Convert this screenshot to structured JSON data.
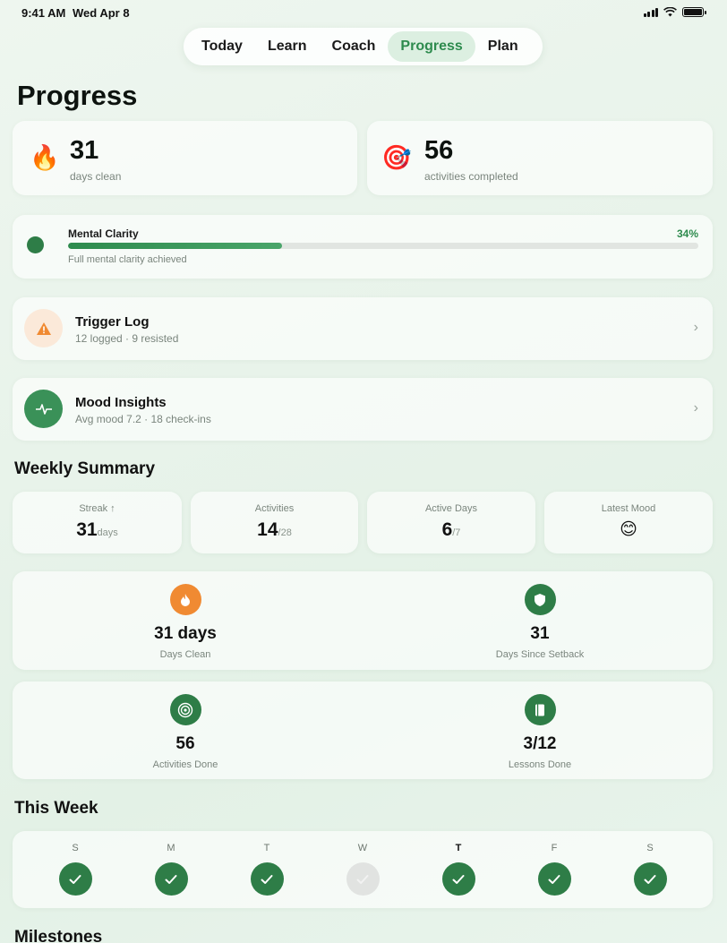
{
  "status": {
    "time": "9:41 AM",
    "date": "Wed Apr 8"
  },
  "tabs": [
    {
      "label": "Today"
    },
    {
      "label": "Learn"
    },
    {
      "label": "Coach"
    },
    {
      "label": "Progress",
      "active": true
    },
    {
      "label": "Plan"
    }
  ],
  "page_title": "Progress",
  "stats": {
    "days_clean": {
      "icon": "fire-icon",
      "value": "31",
      "label": "days clean"
    },
    "activities": {
      "icon": "target-icon",
      "value": "56",
      "label": "activities completed"
    }
  },
  "clarity": {
    "title": "Mental Clarity",
    "percent_label": "34%",
    "progress": 0.34,
    "subtitle": "Full mental clarity achieved"
  },
  "trigger_log": {
    "title": "Trigger Log",
    "subtitle": "12 logged · 9 resisted"
  },
  "mood_insights": {
    "title": "Mood Insights",
    "subtitle": "Avg mood 7.2 · 18 check-ins"
  },
  "weekly_summary": {
    "title": "Weekly Summary",
    "items": [
      {
        "label": "Streak ↑",
        "value": "31",
        "unit": "days"
      },
      {
        "label": "Activities",
        "value": "14",
        "unit": "/28"
      },
      {
        "label": "Active Days",
        "value": "6",
        "unit": "/7"
      },
      {
        "label": "Latest Mood",
        "value": "😊",
        "unit": ""
      }
    ]
  },
  "tiles": [
    {
      "value": "31 days",
      "label": "Days Clean",
      "icon": "fire-icon",
      "color": "#f08a32"
    },
    {
      "value": "31",
      "label": "Days Since Setback",
      "icon": "shield-icon",
      "color": "#2e7d47"
    },
    {
      "value": "56",
      "label": "Activities Done",
      "icon": "target-icon",
      "color": "#2e7d47"
    },
    {
      "value": "3/12",
      "label": "Lessons Done",
      "icon": "book-icon",
      "color": "#2e7d47"
    }
  ],
  "this_week": {
    "title": "This Week",
    "days": [
      {
        "label": "S",
        "done": true
      },
      {
        "label": "M",
        "done": true
      },
      {
        "label": "T",
        "done": true
      },
      {
        "label": "W",
        "done": false
      },
      {
        "label": "T",
        "done": true,
        "today": true
      },
      {
        "label": "F",
        "done": true
      },
      {
        "label": "S",
        "done": true
      }
    ]
  },
  "milestones_title": "Milestones",
  "colors": {
    "accent": "#2e8b4e",
    "accent_dark": "#2e7d47",
    "warning": "#f08a32"
  }
}
